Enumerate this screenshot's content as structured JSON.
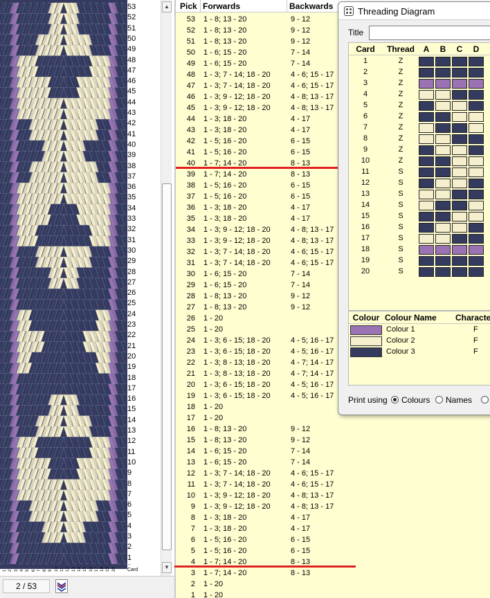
{
  "weave_pane": {
    "pick_numbers": [
      "53",
      "52",
      "51",
      "50",
      "49",
      "48",
      "47",
      "46",
      "45",
      "44",
      "43",
      "42",
      "41",
      "40",
      "39",
      "38",
      "37",
      "36",
      "35",
      "34",
      "33",
      "32",
      "31",
      "30",
      "29",
      "28",
      "27",
      "26",
      "25",
      "24",
      "23",
      "22",
      "21",
      "20",
      "19",
      "18",
      "17",
      "16",
      "15",
      "14",
      "13",
      "12",
      "11",
      "10",
      "9",
      "8",
      "7",
      "6",
      "5",
      "4",
      "3",
      "2",
      "1"
    ],
    "card_numbers": [
      "1",
      "2",
      "3",
      "4",
      "5",
      "6",
      "7",
      "8",
      "9",
      "10",
      "11",
      "12",
      "13",
      "14",
      "15",
      "16",
      "17",
      "18",
      "19",
      "20"
    ],
    "card_label": "Card",
    "arrow": "←",
    "scroll_up": "▲",
    "scroll_down": "▼"
  },
  "status": {
    "page": "2 / 53"
  },
  "pick_table": {
    "headers": {
      "pick": "Pick",
      "forwards": "Forwards",
      "backwards": "Backwards"
    },
    "rows": [
      {
        "pick": "53",
        "forwards": "1 - 8; 13 - 20",
        "backwards": "9 - 12"
      },
      {
        "pick": "52",
        "forwards": "1 - 8; 13 - 20",
        "backwards": "9 - 12"
      },
      {
        "pick": "51",
        "forwards": "1 - 8; 13 - 20",
        "backwards": "9 - 12"
      },
      {
        "pick": "50",
        "forwards": "1 - 6; 15 - 20",
        "backwards": "7 - 14"
      },
      {
        "pick": "49",
        "forwards": "1 - 6; 15 - 20",
        "backwards": "7 - 14"
      },
      {
        "pick": "48",
        "forwards": "1 - 3; 7 - 14; 18 - 20",
        "backwards": "4 - 6; 15 - 17"
      },
      {
        "pick": "47",
        "forwards": "1 - 3; 7 - 14; 18 - 20",
        "backwards": "4 - 6; 15 - 17"
      },
      {
        "pick": "46",
        "forwards": "1 - 3; 9 - 12; 18 - 20",
        "backwards": "4 - 8; 13 - 17"
      },
      {
        "pick": "45",
        "forwards": "1 - 3; 9 - 12; 18 - 20",
        "backwards": "4 - 8; 13 - 17"
      },
      {
        "pick": "44",
        "forwards": "1 - 3; 18 - 20",
        "backwards": "4 - 17"
      },
      {
        "pick": "43",
        "forwards": "1 - 3; 18 - 20",
        "backwards": "4 - 17"
      },
      {
        "pick": "42",
        "forwards": "1 - 5; 16 - 20",
        "backwards": "6 - 15"
      },
      {
        "pick": "41",
        "forwards": "1 - 5; 16 - 20",
        "backwards": "6 - 15"
      },
      {
        "pick": "40",
        "forwards": "1 - 7; 14 - 20",
        "backwards": "8 - 13"
      },
      {
        "pick": "39",
        "forwards": "1 - 7; 14 - 20",
        "backwards": "8 - 13"
      },
      {
        "pick": "38",
        "forwards": "1 - 5; 16 - 20",
        "backwards": "6 - 15"
      },
      {
        "pick": "37",
        "forwards": "1 - 5; 16 - 20",
        "backwards": "6 - 15"
      },
      {
        "pick": "36",
        "forwards": "1 - 3; 18 - 20",
        "backwards": "4 - 17"
      },
      {
        "pick": "35",
        "forwards": "1 - 3; 18 - 20",
        "backwards": "4 - 17"
      },
      {
        "pick": "34",
        "forwards": "1 - 3; 9 - 12; 18 - 20",
        "backwards": "4 - 8; 13 - 17"
      },
      {
        "pick": "33",
        "forwards": "1 - 3; 9 - 12; 18 - 20",
        "backwards": "4 - 8; 13 - 17"
      },
      {
        "pick": "32",
        "forwards": "1 - 3; 7 - 14; 18 - 20",
        "backwards": "4 - 6; 15 - 17"
      },
      {
        "pick": "31",
        "forwards": "1 - 3; 7 - 14; 18 - 20",
        "backwards": "4 - 6; 15 - 17"
      },
      {
        "pick": "30",
        "forwards": "1 - 6; 15 - 20",
        "backwards": "7 - 14"
      },
      {
        "pick": "29",
        "forwards": "1 - 6; 15 - 20",
        "backwards": "7 - 14"
      },
      {
        "pick": "28",
        "forwards": "1 - 8; 13 - 20",
        "backwards": "9 - 12"
      },
      {
        "pick": "27",
        "forwards": "1 - 8; 13 - 20",
        "backwards": "9 - 12"
      },
      {
        "pick": "26",
        "forwards": "1 - 20",
        "backwards": ""
      },
      {
        "pick": "25",
        "forwards": "1 - 20",
        "backwards": ""
      },
      {
        "pick": "24",
        "forwards": "1 - 3; 6 - 15; 18 - 20",
        "backwards": "4 - 5; 16 - 17"
      },
      {
        "pick": "23",
        "forwards": "1 - 3; 6 - 15; 18 - 20",
        "backwards": "4 - 5; 16 - 17"
      },
      {
        "pick": "22",
        "forwards": "1 - 3; 8 - 13; 18 - 20",
        "backwards": "4 - 7; 14 - 17"
      },
      {
        "pick": "21",
        "forwards": "1 - 3; 8 - 13; 18 - 20",
        "backwards": "4 - 7; 14 - 17"
      },
      {
        "pick": "20",
        "forwards": "1 - 3; 6 - 15; 18 - 20",
        "backwards": "4 - 5; 16 - 17"
      },
      {
        "pick": "19",
        "forwards": "1 - 3; 6 - 15; 18 - 20",
        "backwards": "4 - 5; 16 - 17"
      },
      {
        "pick": "18",
        "forwards": "1 - 20",
        "backwards": ""
      },
      {
        "pick": "17",
        "forwards": "1 - 20",
        "backwards": ""
      },
      {
        "pick": "16",
        "forwards": "1 - 8; 13 - 20",
        "backwards": "9 - 12"
      },
      {
        "pick": "15",
        "forwards": "1 - 8; 13 - 20",
        "backwards": "9 - 12"
      },
      {
        "pick": "14",
        "forwards": "1 - 6; 15 - 20",
        "backwards": "7 - 14"
      },
      {
        "pick": "13",
        "forwards": "1 - 6; 15 - 20",
        "backwards": "7 - 14"
      },
      {
        "pick": "12",
        "forwards": "1 - 3; 7 - 14; 18 - 20",
        "backwards": "4 - 6; 15 - 17"
      },
      {
        "pick": "11",
        "forwards": "1 - 3; 7 - 14; 18 - 20",
        "backwards": "4 - 6; 15 - 17"
      },
      {
        "pick": "10",
        "forwards": "1 - 3; 9 - 12; 18 - 20",
        "backwards": "4 - 8; 13 - 17"
      },
      {
        "pick": "9",
        "forwards": "1 - 3; 9 - 12; 18 - 20",
        "backwards": "4 - 8; 13 - 17"
      },
      {
        "pick": "8",
        "forwards": "1 - 3; 18 - 20",
        "backwards": "4 - 17"
      },
      {
        "pick": "7",
        "forwards": "1 - 3; 18 - 20",
        "backwards": "4 - 17"
      },
      {
        "pick": "6",
        "forwards": "1 - 5; 16 - 20",
        "backwards": "6 - 15"
      },
      {
        "pick": "5",
        "forwards": "1 - 5; 16 - 20",
        "backwards": "6 - 15"
      },
      {
        "pick": "4",
        "forwards": "1 - 7; 14 - 20",
        "backwards": "8 - 13"
      },
      {
        "pick": "3",
        "forwards": "1 - 7; 14 - 20",
        "backwards": "8 - 13"
      },
      {
        "pick": "2",
        "forwards": "1 - 20",
        "backwards": ""
      },
      {
        "pick": "1",
        "forwards": "1 - 20",
        "backwards": ""
      }
    ]
  },
  "threading": {
    "title": "Threading Diagram",
    "title_label": "Title",
    "title_value": "",
    "headers": {
      "card": "Card",
      "thread": "Thread",
      "holes": [
        "A",
        "B",
        "C",
        "D"
      ]
    },
    "cards": [
      {
        "card": "1",
        "thread": "Z",
        "holes": [
          3,
          3,
          3,
          3
        ]
      },
      {
        "card": "2",
        "thread": "Z",
        "holes": [
          3,
          3,
          3,
          3
        ]
      },
      {
        "card": "3",
        "thread": "Z",
        "holes": [
          1,
          1,
          1,
          1
        ]
      },
      {
        "card": "4",
        "thread": "Z",
        "holes": [
          2,
          2,
          3,
          3
        ]
      },
      {
        "card": "5",
        "thread": "Z",
        "holes": [
          3,
          2,
          2,
          3
        ]
      },
      {
        "card": "6",
        "thread": "Z",
        "holes": [
          3,
          3,
          2,
          2
        ]
      },
      {
        "card": "7",
        "thread": "Z",
        "holes": [
          2,
          3,
          3,
          2
        ]
      },
      {
        "card": "8",
        "thread": "Z",
        "holes": [
          2,
          2,
          3,
          3
        ]
      },
      {
        "card": "9",
        "thread": "Z",
        "holes": [
          3,
          2,
          2,
          3
        ]
      },
      {
        "card": "10",
        "thread": "Z",
        "holes": [
          3,
          3,
          2,
          2
        ]
      },
      {
        "card": "11",
        "thread": "S",
        "holes": [
          3,
          3,
          2,
          2
        ]
      },
      {
        "card": "12",
        "thread": "S",
        "holes": [
          3,
          2,
          2,
          3
        ]
      },
      {
        "card": "13",
        "thread": "S",
        "holes": [
          2,
          2,
          3,
          3
        ]
      },
      {
        "card": "14",
        "thread": "S",
        "holes": [
          2,
          3,
          3,
          2
        ]
      },
      {
        "card": "15",
        "thread": "S",
        "holes": [
          3,
          3,
          2,
          2
        ]
      },
      {
        "card": "16",
        "thread": "S",
        "holes": [
          3,
          2,
          2,
          3
        ]
      },
      {
        "card": "17",
        "thread": "S",
        "holes": [
          2,
          2,
          3,
          3
        ]
      },
      {
        "card": "18",
        "thread": "S",
        "holes": [
          1,
          1,
          1,
          1
        ]
      },
      {
        "card": "19",
        "thread": "S",
        "holes": [
          3,
          3,
          3,
          3
        ]
      },
      {
        "card": "20",
        "thread": "S",
        "holes": [
          3,
          3,
          3,
          3
        ]
      }
    ],
    "colour_headers": {
      "colour": "Colour",
      "name": "Colour Name",
      "character": "Characte"
    },
    "colours": [
      {
        "name": "Colour 1",
        "character": "F",
        "hex": "#9b72b4"
      },
      {
        "name": "Colour 2",
        "character": "F",
        "hex": "#f6efce"
      },
      {
        "name": "Colour 3",
        "character": "F",
        "hex": "#343b5f"
      }
    ],
    "print_label": "Print using",
    "print_options": [
      {
        "label": "Colours",
        "selected": true
      },
      {
        "label": "Names",
        "selected": false
      },
      {
        "label": "",
        "selected": false
      }
    ]
  },
  "colors": {
    "purple": "#9b72b4",
    "cream": "#f6efce",
    "navy": "#343b5f",
    "marker_red": "#e02020",
    "table_bg": "#fffed0"
  }
}
